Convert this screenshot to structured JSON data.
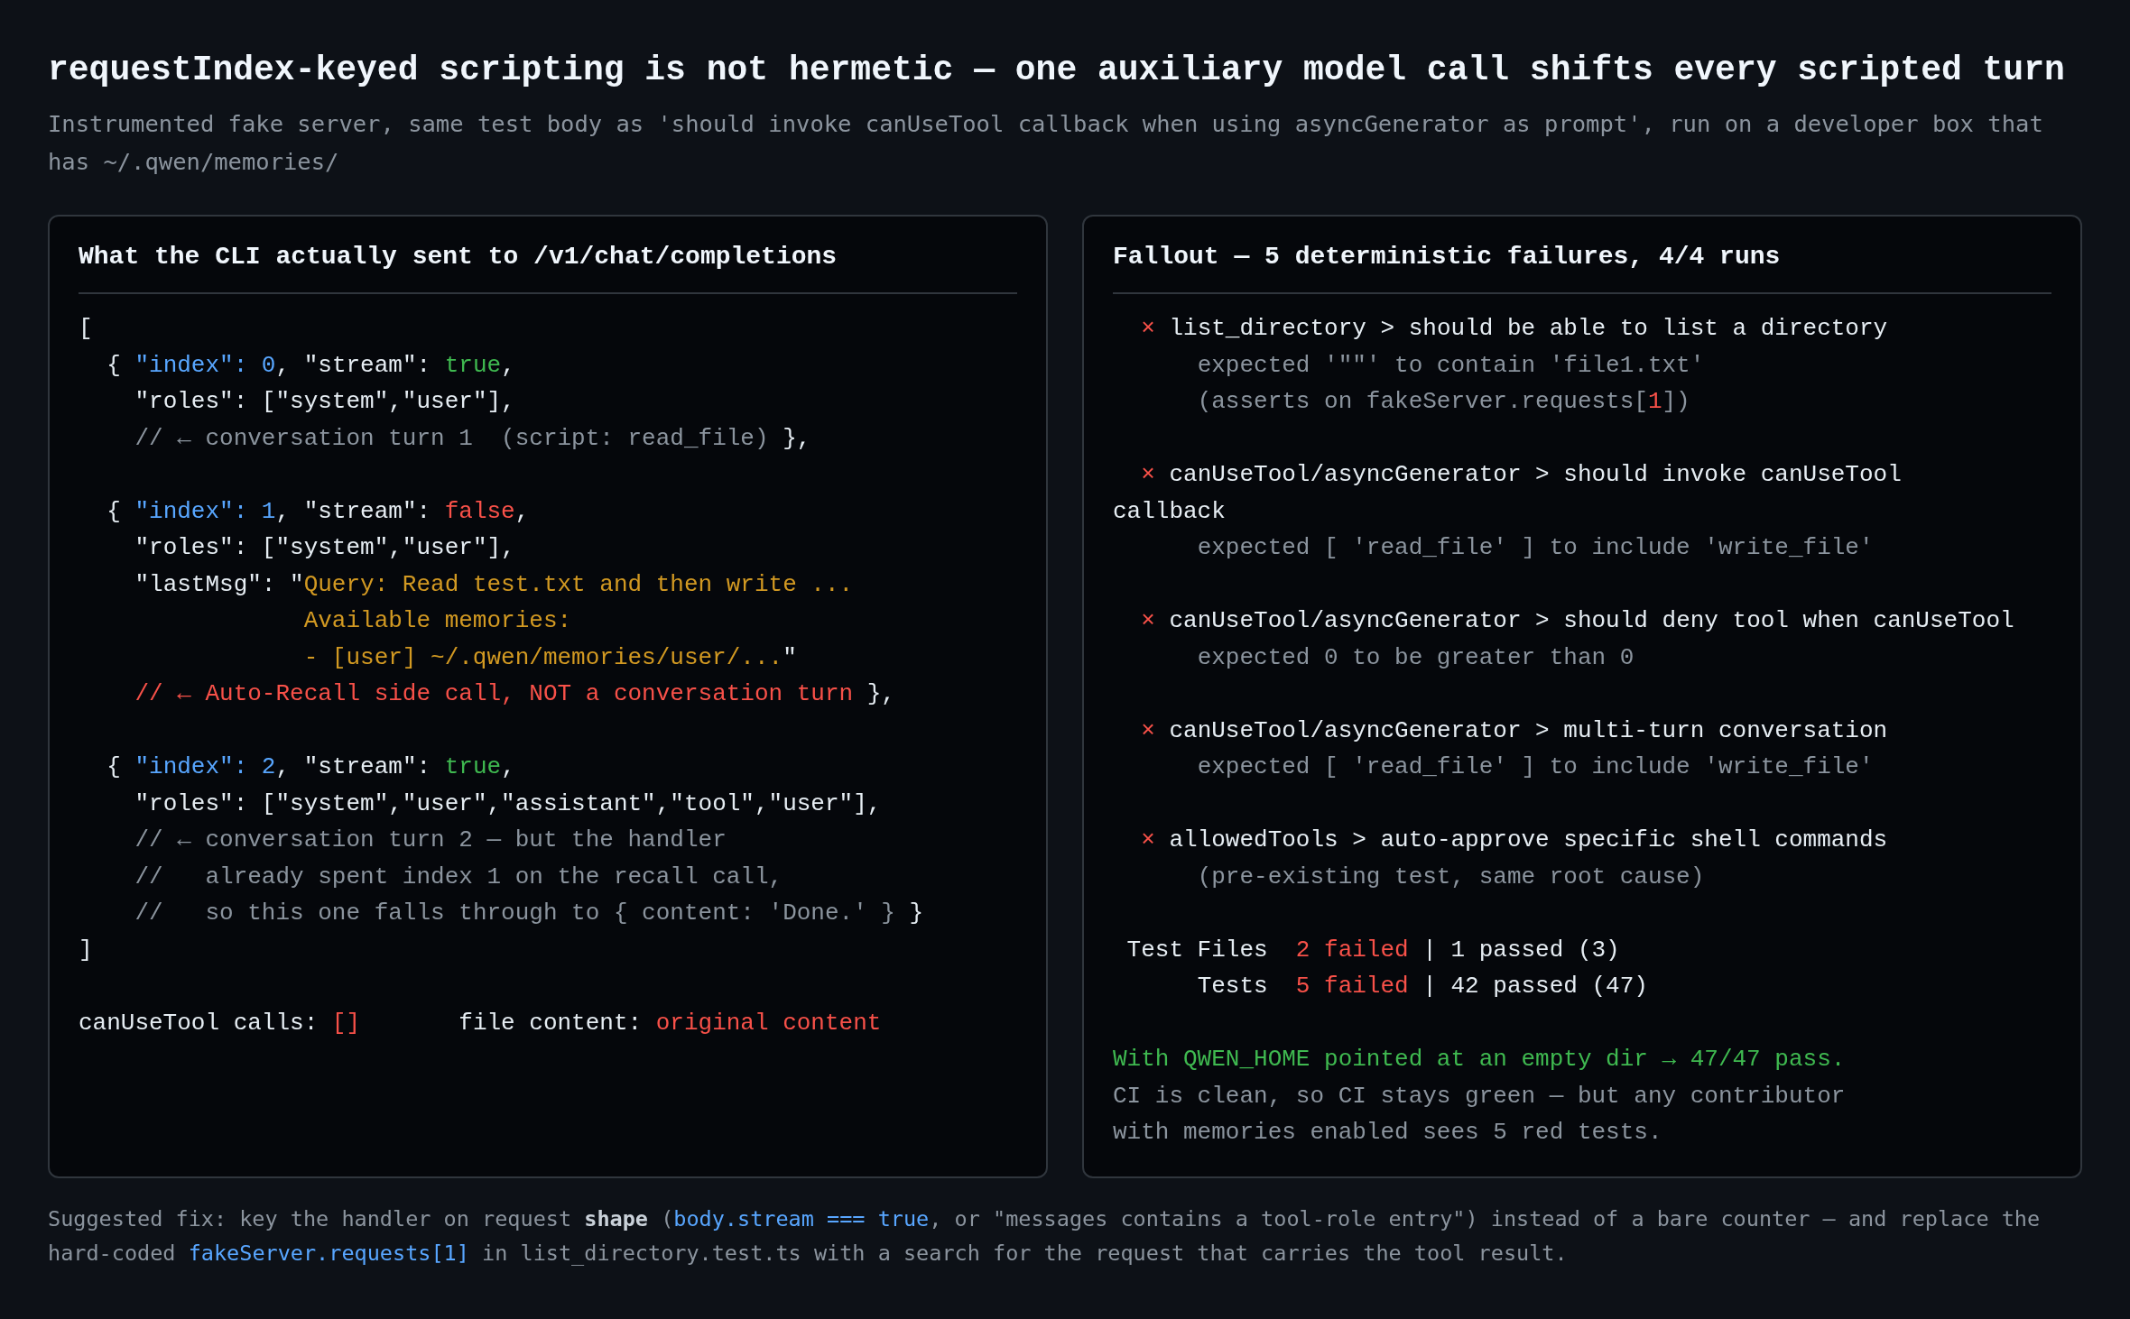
{
  "title": "requestIndex-keyed scripting is not hermetic — one auxiliary model call shifts every scripted turn",
  "subtitle": "Instrumented fake server, same test body as 'should invoke canUseTool callback when using asyncGenerator as prompt', run on a developer box that has ~/.qwen/memories/",
  "panels": [
    {
      "title": "What the CLI actually sent to /v1/chat/completions",
      "blocks": [
        [
          {
            "segments": [
              {
                "text": "[",
                "kind": "plain"
              }
            ]
          },
          {
            "segments": [
              {
                "text": "  { ",
                "kind": "plain"
              },
              {
                "text": "\"index\": 0",
                "kind": "blue"
              },
              {
                "text": ", \"stream\": ",
                "kind": "plain"
              },
              {
                "text": "true",
                "kind": "green"
              },
              {
                "text": ",",
                "kind": "plain"
              }
            ]
          },
          {
            "segments": [
              {
                "text": "    \"roles\": [\"system\",\"user\"],",
                "kind": "plain"
              }
            ]
          },
          {
            "segments": [
              {
                "text": "    // ← conversation turn 1  (script: read_file)",
                "kind": "muted"
              },
              {
                "text": " },",
                "kind": "plain"
              }
            ]
          }
        ],
        [
          {
            "segments": [
              {
                "text": "  { ",
                "kind": "plain"
              },
              {
                "text": "\"index\": 1",
                "kind": "blue"
              },
              {
                "text": ", \"stream\": ",
                "kind": "plain"
              },
              {
                "text": "false",
                "kind": "red"
              },
              {
                "text": ",",
                "kind": "plain"
              }
            ]
          },
          {
            "segments": [
              {
                "text": "    \"roles\": [\"system\",\"user\"],",
                "kind": "plain"
              }
            ]
          },
          {
            "segments": [
              {
                "text": "    \"lastMsg\": \"",
                "kind": "plain"
              },
              {
                "text": "Query: Read test.txt and then write ...",
                "kind": "orange"
              }
            ]
          },
          {
            "segments": [
              {
                "text": "                Available memories:",
                "kind": "orange"
              }
            ]
          },
          {
            "segments": [
              {
                "text": "                - [user] ~/.qwen/memories/user/...",
                "kind": "orange"
              },
              {
                "text": "\"",
                "kind": "plain"
              }
            ]
          },
          {
            "segments": [
              {
                "text": "    // ← Auto-Recall side call, NOT a conversation turn",
                "kind": "red"
              },
              {
                "text": " },",
                "kind": "plain"
              }
            ]
          }
        ],
        [
          {
            "segments": [
              {
                "text": "  { ",
                "kind": "plain"
              },
              {
                "text": "\"index\": 2",
                "kind": "blue"
              },
              {
                "text": ", \"stream\": ",
                "kind": "plain"
              },
              {
                "text": "true",
                "kind": "green"
              },
              {
                "text": ",",
                "kind": "plain"
              }
            ]
          },
          {
            "segments": [
              {
                "text": "    \"roles\": [\"system\",\"user\",\"assistant\",\"tool\",\"user\"],",
                "kind": "plain"
              }
            ]
          },
          {
            "segments": [
              {
                "text": "    // ← conversation turn 2 — but the handler",
                "kind": "muted"
              }
            ]
          },
          {
            "segments": [
              {
                "text": "    //   already spent index 1 on the recall call,",
                "kind": "muted"
              }
            ]
          },
          {
            "segments": [
              {
                "text": "    //   so this one falls through to { content: 'Done.' }",
                "kind": "muted"
              },
              {
                "text": " }",
                "kind": "plain"
              }
            ]
          },
          {
            "segments": [
              {
                "text": "]",
                "kind": "plain"
              }
            ]
          }
        ],
        [
          {
            "segments": [
              {
                "text": "canUseTool calls: ",
                "kind": "plain"
              },
              {
                "text": "[]",
                "kind": "red"
              },
              {
                "text": "       file content: ",
                "kind": "plain"
              },
              {
                "text": "original content",
                "kind": "red"
              }
            ]
          }
        ]
      ]
    },
    {
      "title": "Fallout — 5 deterministic failures, 4/4 runs",
      "blocks": [
        [
          {
            "segments": [
              {
                "text": "  × ",
                "kind": "red"
              },
              {
                "text": "list_directory > should be able to list a directory",
                "kind": "plain"
              }
            ]
          },
          {
            "segments": [
              {
                "text": "      expected '\"\"' to contain 'file1.txt'",
                "kind": "muted"
              }
            ]
          },
          {
            "segments": [
              {
                "text": "      (asserts on fakeServer.requests[",
                "kind": "muted"
              },
              {
                "text": "1",
                "kind": "red"
              },
              {
                "text": "])",
                "kind": "muted"
              }
            ]
          }
        ],
        [
          {
            "segments": [
              {
                "text": "  × ",
                "kind": "red"
              },
              {
                "text": "canUseTool/asyncGenerator > should invoke canUseTool callback",
                "kind": "plain"
              }
            ]
          },
          {
            "segments": [
              {
                "text": "      expected [ 'read_file' ] to include 'write_file'",
                "kind": "muted"
              }
            ]
          }
        ],
        [
          {
            "segments": [
              {
                "text": "  × ",
                "kind": "red"
              },
              {
                "text": "canUseTool/asyncGenerator > should deny tool when canUseTool",
                "kind": "plain"
              }
            ]
          },
          {
            "segments": [
              {
                "text": "      expected 0 to be greater than 0",
                "kind": "muted"
              }
            ]
          }
        ],
        [
          {
            "segments": [
              {
                "text": "  × ",
                "kind": "red"
              },
              {
                "text": "canUseTool/asyncGenerator > multi-turn conversation",
                "kind": "plain"
              }
            ]
          },
          {
            "segments": [
              {
                "text": "      expected [ 'read_file' ] to include 'write_file'",
                "kind": "muted"
              }
            ]
          }
        ],
        [
          {
            "segments": [
              {
                "text": "  × ",
                "kind": "red"
              },
              {
                "text": "allowedTools > auto-approve specific shell commands",
                "kind": "plain"
              }
            ]
          },
          {
            "segments": [
              {
                "text": "      (pre-existing test, same root cause)",
                "kind": "muted"
              }
            ]
          }
        ],
        [
          {
            "segments": [
              {
                "text": " Test Files  ",
                "kind": "plain"
              },
              {
                "text": "2 failed",
                "kind": "red"
              },
              {
                "text": " | 1 passed (3)",
                "kind": "plain"
              }
            ]
          },
          {
            "segments": [
              {
                "text": "      Tests  ",
                "kind": "plain"
              },
              {
                "text": "5 failed",
                "kind": "red"
              },
              {
                "text": " | 42 passed (47)",
                "kind": "plain"
              }
            ]
          }
        ],
        [
          {
            "segments": [
              {
                "text": "With QWEN_HOME pointed at an empty dir → 47/47 pass.",
                "kind": "green"
              }
            ]
          },
          {
            "segments": [
              {
                "text": "CI is clean, so CI stays green — but any contributor",
                "kind": "muted"
              }
            ]
          },
          {
            "segments": [
              {
                "text": "with memories enabled sees 5 red tests.",
                "kind": "muted"
              }
            ]
          }
        ]
      ]
    }
  ],
  "footer": [
    {
      "text": "Suggested fix: key the handler on request ",
      "kind": "plain"
    },
    {
      "text": "shape",
      "kind": "bold"
    },
    {
      "text": " (",
      "kind": "plain"
    },
    {
      "text": "body.stream === true",
      "kind": "blue"
    },
    {
      "text": ", or \"messages contains a tool-role entry\") instead of a bare counter — and replace the hard-coded ",
      "kind": "plain"
    },
    {
      "text": "fakeServer.requests[1]",
      "kind": "blue"
    },
    {
      "text": " in list_directory.test.ts with a search for the request that carries the tool result.",
      "kind": "plain"
    }
  ]
}
